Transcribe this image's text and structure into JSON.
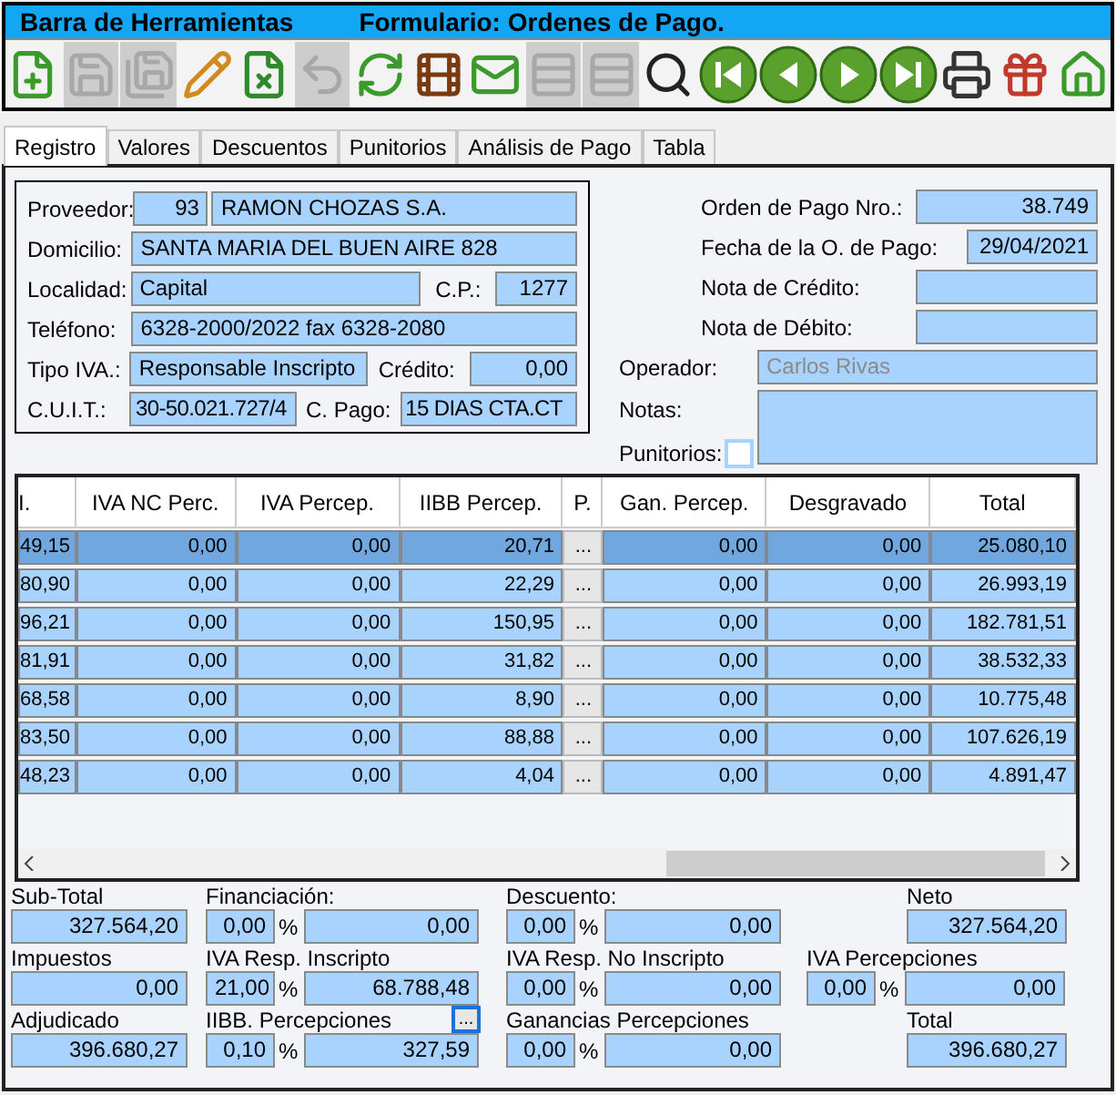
{
  "title_bar": {
    "left": "Barra de Herramientas",
    "right": "Formulario: Ordenes de Pago."
  },
  "toolbar": [
    {
      "kind": "new",
      "disabled": false
    },
    {
      "kind": "save",
      "disabled": true
    },
    {
      "kind": "save_as",
      "disabled": true
    },
    {
      "kind": "edit",
      "disabled": false
    },
    {
      "kind": "delete",
      "disabled": false
    },
    {
      "kind": "undo",
      "disabled": true
    },
    {
      "kind": "refresh",
      "disabled": false
    },
    {
      "kind": "film",
      "disabled": false
    },
    {
      "kind": "mail",
      "disabled": false
    },
    {
      "kind": "rows_add",
      "disabled": true
    },
    {
      "kind": "rows_remove",
      "disabled": true
    },
    {
      "kind": "search",
      "disabled": false
    },
    {
      "kind": "first",
      "disabled": false
    },
    {
      "kind": "prev",
      "disabled": false
    },
    {
      "kind": "next",
      "disabled": false
    },
    {
      "kind": "last",
      "disabled": false
    },
    {
      "kind": "print",
      "disabled": false
    },
    {
      "kind": "gift",
      "disabled": false
    },
    {
      "kind": "home",
      "disabled": false
    }
  ],
  "tabs": [
    {
      "label": "Registro",
      "selected": true
    },
    {
      "label": "Valores",
      "selected": false
    },
    {
      "label": "Descuentos",
      "selected": false
    },
    {
      "label": "Punitorios",
      "selected": false
    },
    {
      "label": "Análisis de Pago",
      "selected": false
    },
    {
      "label": "Tabla",
      "selected": false
    }
  ],
  "supplier": {
    "proveedor": {
      "label": "Proveedor:",
      "code": "93",
      "name": "RAMON CHOZAS S.A."
    },
    "domicilio": {
      "label": "Domicilio:",
      "value": "SANTA MARIA DEL BUEN AIRE 828"
    },
    "localidad": {
      "label": "Localidad:",
      "value": "Capital",
      "cp_label": "C.P.:",
      "cp": "1277"
    },
    "telefono": {
      "label": "Teléfono:",
      "value": "6328-2000/2022 fax 6328-2080"
    },
    "tipo_iva": {
      "label": "Tipo IVA.:",
      "value": "Responsable Inscripto",
      "credito_label": "Crédito:",
      "credito": "0,00"
    },
    "cuit": {
      "label": "C.U.I.T.:",
      "value": "30-50.021.727/4",
      "pago_label": "C. Pago:",
      "pago": "15 DIAS CTA.CT"
    }
  },
  "order": {
    "numero": {
      "label": "Orden de Pago Nro.:",
      "value": "38.749"
    },
    "fecha": {
      "label": "Fecha de la O. de Pago:",
      "value": "29/04/2021"
    },
    "nota_credito": {
      "label": "Nota de Crédito:"
    },
    "nota_debito": {
      "label": "Nota de Débito:"
    },
    "operador": {
      "label": "Operador:",
      "value": "Carlos Rivas",
      "disabled": true
    },
    "notas": {
      "label": "Notas:"
    },
    "punitorios": {
      "label": "Punitorios:",
      "checked": false
    }
  },
  "table": {
    "columns": [
      {
        "label": "I.",
        "kind": "value"
      },
      {
        "label": "IVA NC Perc.",
        "kind": "value"
      },
      {
        "label": "IVA Percep.",
        "kind": "value"
      },
      {
        "label": "IIBB Percep.",
        "kind": "value"
      },
      {
        "label": "P.",
        "kind": "button"
      },
      {
        "label": "Gan. Percep.",
        "kind": "value"
      },
      {
        "label": "Desgravado",
        "kind": "value"
      },
      {
        "label": "Total",
        "kind": "value"
      }
    ],
    "rows": [
      {
        "selected": true,
        "cells": [
          "49,15",
          "0,00",
          "0,00",
          "20,71",
          "...",
          "0,00",
          "0,00",
          "25.080,10"
        ]
      },
      {
        "selected": false,
        "cells": [
          "80,90",
          "0,00",
          "0,00",
          "22,29",
          "...",
          "0,00",
          "0,00",
          "26.993,19"
        ]
      },
      {
        "selected": false,
        "cells": [
          "96,21",
          "0,00",
          "0,00",
          "150,95",
          "...",
          "0,00",
          "0,00",
          "182.781,51"
        ]
      },
      {
        "selected": false,
        "cells": [
          "81,91",
          "0,00",
          "0,00",
          "31,82",
          "...",
          "0,00",
          "0,00",
          "38.532,33"
        ]
      },
      {
        "selected": false,
        "cells": [
          "68,58",
          "0,00",
          "0,00",
          "8,90",
          "...",
          "0,00",
          "0,00",
          "10.775,48"
        ]
      },
      {
        "selected": false,
        "cells": [
          "83,50",
          "0,00",
          "0,00",
          "88,88",
          "...",
          "0,00",
          "0,00",
          "107.626,19"
        ]
      },
      {
        "selected": false,
        "cells": [
          "48,23",
          "0,00",
          "0,00",
          "4,04",
          "...",
          "0,00",
          "0,00",
          "4.891,47"
        ]
      }
    ]
  },
  "totals": [
    [
      {
        "label": "Sub-Total",
        "value": "327.564,20"
      },
      {
        "label": "Financiación:",
        "pct": "0,00",
        "unit": "%",
        "value": "0,00"
      },
      {
        "label": "Descuento:",
        "pct": "0,00",
        "unit": "%",
        "value": "0,00"
      },
      {
        "label": "Neto",
        "value": "327.564,20"
      }
    ],
    [
      {
        "label": "Impuestos",
        "value": "0,00"
      },
      {
        "label": "IVA Resp. Inscripto",
        "pct": "21,00",
        "unit": "%",
        "value": "68.788,48"
      },
      {
        "label": "IVA Resp. No Inscripto",
        "pct": "0,00",
        "unit": "%",
        "value": "0,00"
      },
      {
        "label": "IVA Percepciones",
        "pct": "0,00",
        "unit": "%",
        "value": "0,00"
      }
    ],
    [
      {
        "label": "Adjudicado",
        "value": "396.680,27"
      },
      {
        "label": "IIBB. Percepciones",
        "pct": "0,10",
        "unit": "%",
        "value": "327,59",
        "button": "..."
      },
      {
        "label": "Ganancias Percepciones",
        "pct": "0,00",
        "unit": "%",
        "value": "0,00"
      },
      {
        "label": "Total",
        "value": "396.680,27"
      }
    ]
  ]
}
